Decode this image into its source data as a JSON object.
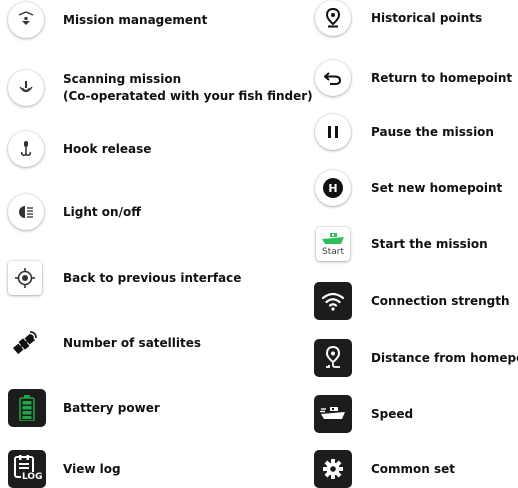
{
  "left": [
    {
      "icon": "mission-management-icon",
      "label": "Mission management"
    },
    {
      "icon": "scanning-mission-icon",
      "label": "Scanning mission",
      "label2": "(Co-operatated with your fish finder)"
    },
    {
      "icon": "hook-release-icon",
      "label": "Hook release"
    },
    {
      "icon": "light-icon",
      "label": "Light on/off"
    },
    {
      "icon": "target-icon",
      "label": "Back to previous interface"
    },
    {
      "icon": "satellite-icon",
      "label": "Number of satellites"
    },
    {
      "icon": "battery-icon",
      "label": "Battery power"
    },
    {
      "icon": "log-icon",
      "label": "View log",
      "icon_text": "LOG"
    }
  ],
  "right": [
    {
      "icon": "location-pin-icon",
      "label": "Historical points"
    },
    {
      "icon": "return-arrow-icon",
      "label": "Return to homepoint"
    },
    {
      "icon": "pause-icon",
      "label": "Pause the mission"
    },
    {
      "icon": "homepoint-h-icon",
      "label": "Set new homepoint",
      "icon_text": "H"
    },
    {
      "icon": "boat-start-icon",
      "label": "Start the mission",
      "icon_text": "Start"
    },
    {
      "icon": "wifi-icon",
      "label": "Connection strength"
    },
    {
      "icon": "distance-pin-icon",
      "label": "Distance from homepoint"
    },
    {
      "icon": "speed-boat-icon",
      "label": "Speed"
    },
    {
      "icon": "gear-icon",
      "label": "Common set"
    }
  ],
  "colors": {
    "battery_green": "#1fa84a",
    "boat_green": "#2fbf5a",
    "dark_tile": "#1c1c1c"
  }
}
